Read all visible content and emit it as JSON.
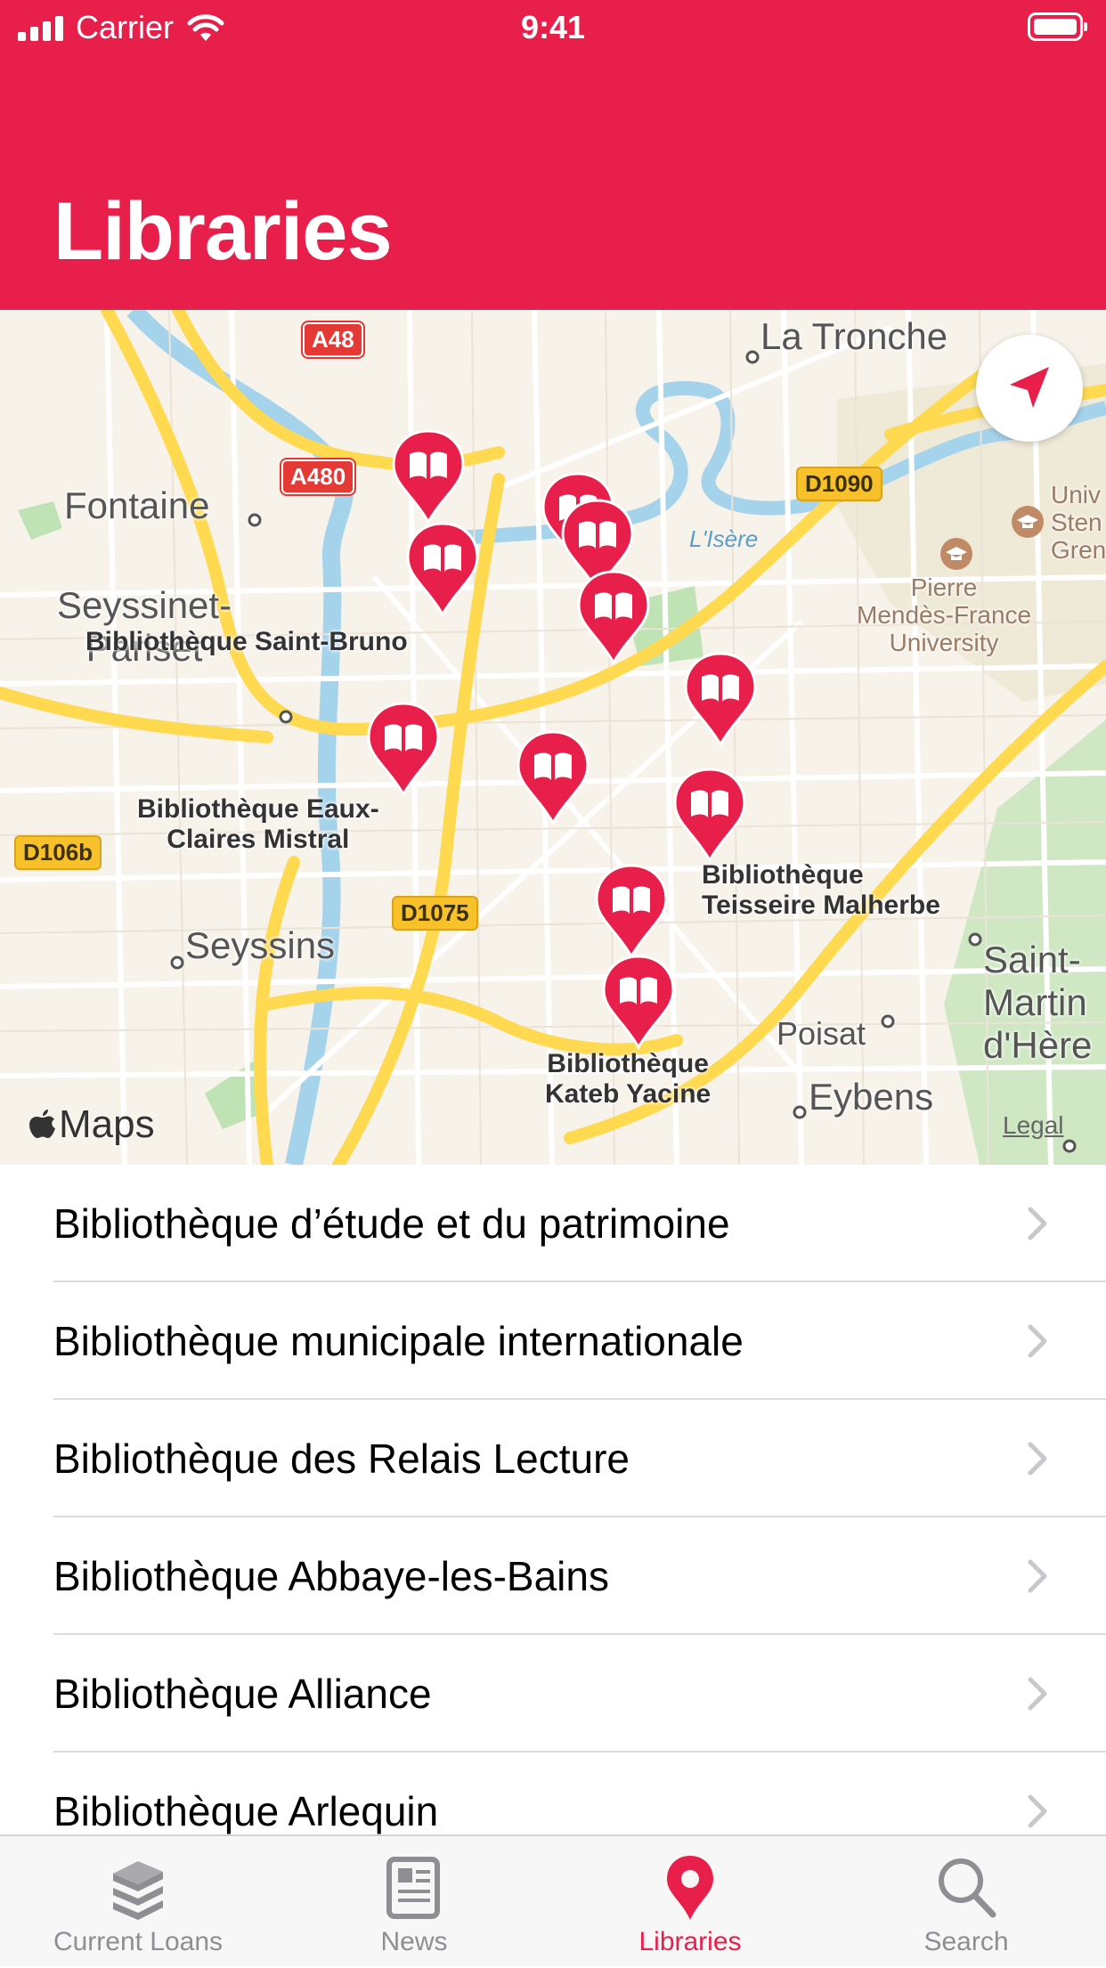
{
  "status_bar": {
    "carrier": "Carrier",
    "time": "9:41"
  },
  "header": {
    "title": "Libraries",
    "background": "#E81F4A"
  },
  "map": {
    "places": {
      "la_tronche": "La Tronche",
      "fontaine": "Fontaine",
      "seyssinet": "Seyssinet-\nPariset",
      "seyssins": "Seyssins",
      "poisat": "Poisat",
      "eybens": "Eybens",
      "saint_martin": "Saint-\nMartin\nd'Hère",
      "university": "Pierre\nMendès-France\nUniversity",
      "univ_partial": "Univ\nSten\nGren"
    },
    "library_labels": {
      "saint_bruno": "Bibliothèque Saint-Bruno",
      "eaux_claires": "Bibliothèque Eaux-\nClaires Mistral",
      "teisseire": "Bibliothèque\nTeisseire Malherbe",
      "kateb": "Bibliothèque\nKateb Yacine"
    },
    "roads": {
      "a48": "A48",
      "a480": "A480",
      "d1090": "D1090",
      "d106b": "D106b",
      "d1075": "D1075"
    },
    "river": "L'Isère",
    "attribution": "Maps",
    "legal": "Legal",
    "pin_color": "#E81F4A",
    "pin_count": 12
  },
  "libraries": [
    {
      "name": "Bibliothèque d’étude et du patrimoine"
    },
    {
      "name": "Bibliothèque municipale internationale"
    },
    {
      "name": "Bibliothèque des Relais Lecture"
    },
    {
      "name": "Bibliothèque Abbaye-les-Bains"
    },
    {
      "name": "Bibliothèque Alliance"
    },
    {
      "name": "Bibliothèque Arlequin"
    }
  ],
  "tab_bar": {
    "active_color": "#E81F4A",
    "inactive_color": "#8E8E93",
    "tabs": [
      {
        "label": "Current Loans",
        "icon": "books-stack-icon"
      },
      {
        "label": "News",
        "icon": "newspaper-icon"
      },
      {
        "label": "Libraries",
        "icon": "map-pin-icon",
        "active": true
      },
      {
        "label": "Search",
        "icon": "magnifier-icon"
      }
    ]
  }
}
